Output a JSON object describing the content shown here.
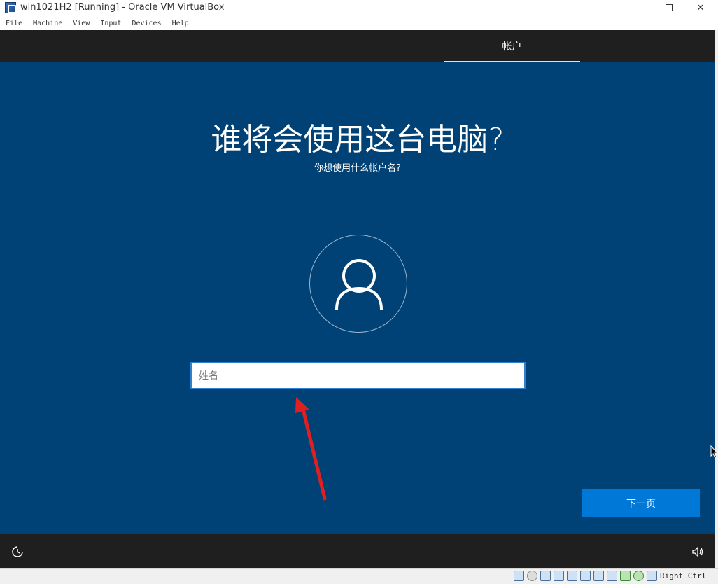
{
  "window": {
    "title": "win1021H2 [Running] - Oracle VM VirtualBox",
    "minimize_glyph": "—",
    "maximize_glyph": "☐",
    "close_glyph": "✕"
  },
  "menu": [
    "File",
    "Machine",
    "View",
    "Input",
    "Devices",
    "Help"
  ],
  "vm": {
    "tab_label": "帐户",
    "heading": "谁将会使用这台电脑?",
    "subheading": "你想使用什么帐户名?",
    "name_input": {
      "placeholder": "姓名",
      "value": ""
    },
    "next_label": "下一页",
    "colors": {
      "background": "#004275",
      "bar": "#1f1f1f",
      "accent": "#0078d7",
      "annotation_arrow": "#e02020"
    },
    "icons": [
      "ease-of-access-icon",
      "volume-icon",
      "user-avatar-icon"
    ]
  },
  "statusbar": {
    "host_key": "Right Ctrl",
    "icons": [
      "harddisk-icon",
      "optical-icon",
      "audio-icon",
      "network-icon",
      "usb-icon",
      "shared-folders-icon",
      "display-icon",
      "recording-icon",
      "cpu-icon",
      "mouse-integration-icon",
      "keyboard-icon"
    ]
  }
}
